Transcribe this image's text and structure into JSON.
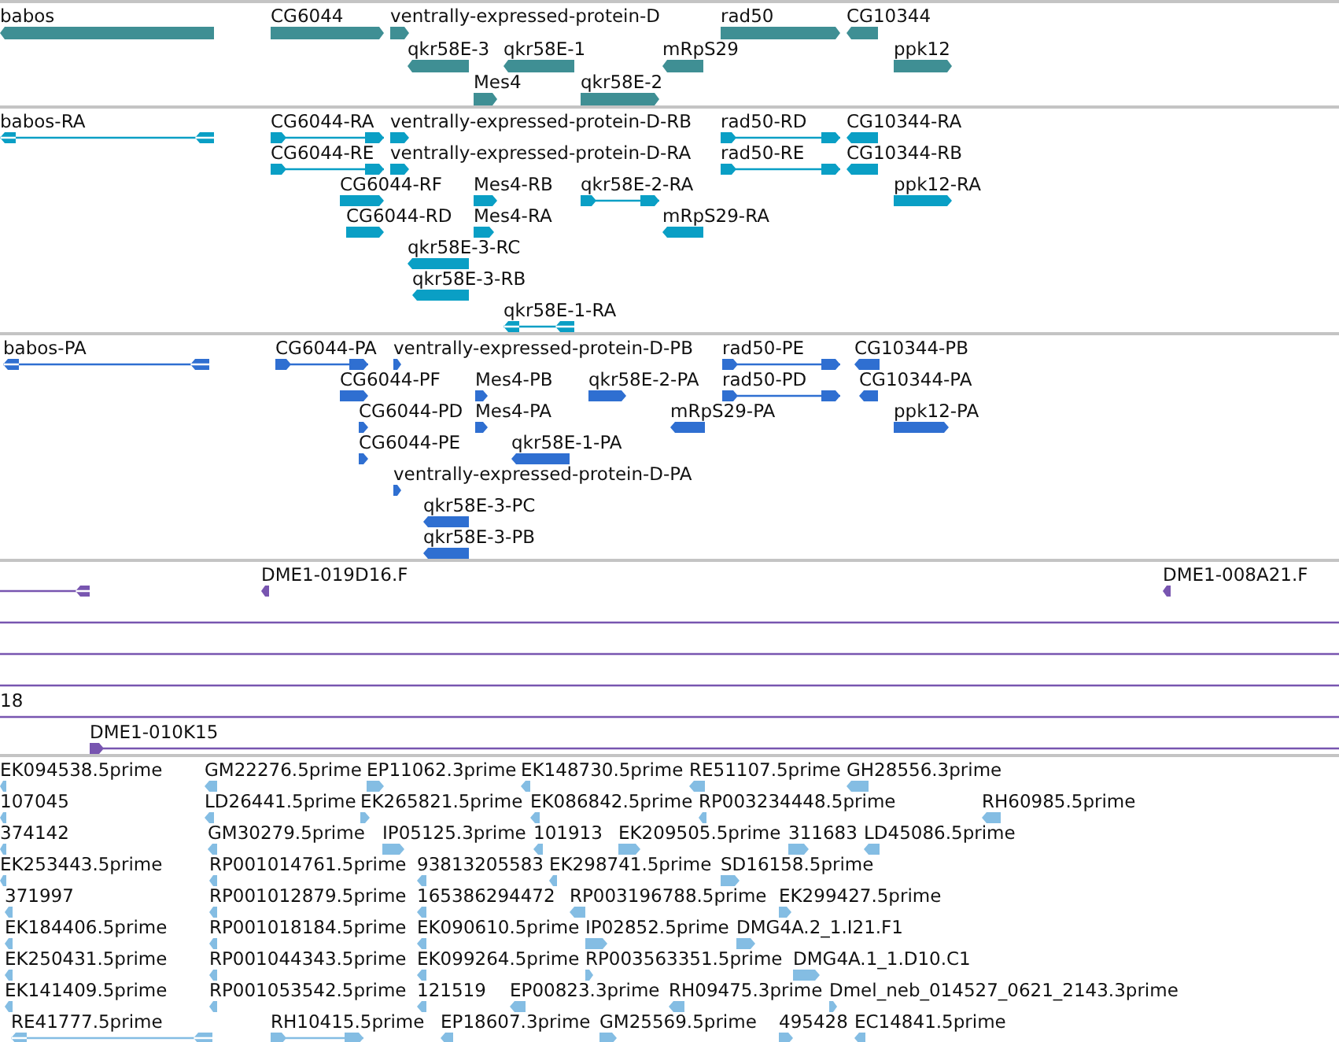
{
  "tracks": [
    {
      "kind": "gene",
      "lanes": [
        {
          "features": [
            {
              "label": "babos",
              "forward": false
            },
            {
              "label": "CG6044",
              "forward": true
            },
            {
              "label": "ventrally-expressed-protein-D",
              "forward": true
            },
            {
              "label": "rad50",
              "forward": true
            },
            {
              "label": "CG10344",
              "forward": false
            }
          ]
        },
        {
          "features": [
            {
              "label": "qkr58E-3",
              "forward": false
            },
            {
              "label": "qkr58E-1",
              "forward": false
            },
            {
              "label": "mRpS29",
              "forward": false
            },
            {
              "label": "ppk12",
              "forward": true
            }
          ]
        },
        {
          "features": [
            {
              "label": "Mes4",
              "forward": true
            },
            {
              "label": "qkr58E-2",
              "forward": true
            }
          ]
        }
      ]
    },
    {
      "kind": "transcript",
      "lanes": [
        {
          "features": [
            {
              "label": "babos-RA",
              "forward": false
            },
            {
              "label": "CG6044-RA",
              "forward": true
            },
            {
              "label": "ventrally-expressed-protein-D-RB",
              "forward": true
            },
            {
              "label": "rad50-RD",
              "forward": true
            },
            {
              "label": "CG10344-RA",
              "forward": false
            }
          ]
        },
        {
          "features": [
            {
              "label": "CG6044-RE",
              "forward": true
            },
            {
              "label": "ventrally-expressed-protein-D-RA",
              "forward": true
            },
            {
              "label": "rad50-RE",
              "forward": true
            },
            {
              "label": "CG10344-RB",
              "forward": false
            }
          ]
        },
        {
          "features": [
            {
              "label": "CG6044-RF",
              "forward": true
            },
            {
              "label": "Mes4-RB",
              "forward": true
            },
            {
              "label": "qkr58E-2-RA",
              "forward": true
            },
            {
              "label": "ppk12-RA",
              "forward": true
            }
          ]
        },
        {
          "features": [
            {
              "label": "CG6044-RD",
              "forward": true
            },
            {
              "label": "Mes4-RA",
              "forward": true
            },
            {
              "label": "mRpS29-RA",
              "forward": false
            }
          ]
        },
        {
          "features": [
            {
              "label": "qkr58E-3-RC",
              "forward": false
            }
          ]
        },
        {
          "features": [
            {
              "label": "qkr58E-3-RB",
              "forward": false
            }
          ]
        },
        {
          "features": [
            {
              "label": "qkr58E-1-RA",
              "forward": false
            }
          ]
        }
      ]
    },
    {
      "kind": "protein",
      "lanes": [
        {
          "features": [
            {
              "label": "babos-PA",
              "forward": false
            },
            {
              "label": "CG6044-PA",
              "forward": true
            },
            {
              "label": "ventrally-expressed-protein-D-PB",
              "forward": true
            },
            {
              "label": "rad50-PE",
              "forward": true
            },
            {
              "label": "CG10344-PB",
              "forward": false
            }
          ]
        },
        {
          "features": [
            {
              "label": "CG6044-PF",
              "forward": true
            },
            {
              "label": "Mes4-PB",
              "forward": true
            },
            {
              "label": "qkr58E-2-PA",
              "forward": true
            },
            {
              "label": "rad50-PD",
              "forward": true
            },
            {
              "label": "CG10344-PA",
              "forward": false
            }
          ]
        },
        {
          "features": [
            {
              "label": "CG6044-PD",
              "forward": true
            },
            {
              "label": "Mes4-PA",
              "forward": true
            },
            {
              "label": "mRpS29-PA",
              "forward": false
            },
            {
              "label": "ppk12-PA",
              "forward": true
            }
          ]
        },
        {
          "features": [
            {
              "label": "CG6044-PE",
              "forward": true
            },
            {
              "label": "qkr58E-1-PA",
              "forward": false
            }
          ]
        },
        {
          "features": [
            {
              "label": "ventrally-expressed-protein-D-PA",
              "forward": true
            }
          ]
        },
        {
          "features": [
            {
              "label": "qkr58E-3-PC",
              "forward": false
            }
          ]
        },
        {
          "features": [
            {
              "label": "qkr58E-3-PB",
              "forward": false
            }
          ]
        }
      ]
    },
    {
      "kind": "bac",
      "lanes": [
        {
          "features": [
            {
              "kind": "arrow",
              "forward": false
            },
            {
              "kind": "arrow",
              "label": "DME1-019D16.F",
              "forward": false
            },
            {
              "kind": "arrow",
              "label": "DME1-008A21.F",
              "forward": false
            }
          ]
        },
        {
          "features": [
            {
              "kind": "line"
            }
          ]
        },
        {
          "features": [
            {
              "kind": "line"
            }
          ]
        },
        {
          "features": [
            {
              "kind": "line"
            }
          ]
        },
        {
          "features": [
            {
              "kind": "line",
              "label": "18"
            }
          ]
        },
        {
          "features": [
            {
              "kind": "arrow",
              "label": "DME1-010K15",
              "forward": true
            }
          ]
        }
      ]
    },
    {
      "kind": "est",
      "lanes": [
        {
          "features": [
            {
              "label": "EK094538.5prime",
              "forward": false
            },
            {
              "label": "GM22276.5prime",
              "forward": false
            },
            {
              "label": "EP11062.3prime",
              "forward": true
            },
            {
              "label": "EK148730.5prime",
              "forward": false
            },
            {
              "label": "RE51107.5prime",
              "forward": false
            },
            {
              "label": "GH28556.3prime",
              "forward": false
            }
          ]
        },
        {
          "features": [
            {
              "label": "107045",
              "forward": false
            },
            {
              "label": "LD26441.5prime",
              "forward": false
            },
            {
              "label": "EK265821.5prime",
              "forward": true
            },
            {
              "label": "EK086842.5prime",
              "forward": false
            },
            {
              "label": "RP003234448.5prime",
              "forward": false
            },
            {
              "label": "RH60985.5prime",
              "forward": false
            }
          ]
        },
        {
          "features": [
            {
              "label": "374142",
              "forward": false
            },
            {
              "label": "GM30279.5prime",
              "forward": false
            },
            {
              "label": "IP05125.3prime",
              "forward": true
            },
            {
              "label": "101913",
              "forward": false
            },
            {
              "label": "EK209505.5prime",
              "forward": true
            },
            {
              "label": "311683",
              "forward": true
            },
            {
              "label": "LD45086.5prime",
              "forward": false
            }
          ]
        },
        {
          "features": [
            {
              "label": "EK253443.5prime",
              "forward": false
            },
            {
              "label": "RP001014761.5prime",
              "forward": false
            },
            {
              "label": "93813205583",
              "forward": false
            },
            {
              "label": "EK298741.5prime",
              "forward": false
            },
            {
              "label": "SD16158.5prime",
              "forward": true
            }
          ]
        },
        {
          "features": [
            {
              "label": "371997",
              "forward": false
            },
            {
              "label": "RP001012879.5prime",
              "forward": false
            },
            {
              "label": "165386294472",
              "forward": false
            },
            {
              "label": "RP003196788.5prime",
              "forward": false
            },
            {
              "label": "EK299427.5prime",
              "forward": true
            }
          ]
        },
        {
          "features": [
            {
              "label": "EK184406.5prime",
              "forward": false
            },
            {
              "label": "RP001018184.5prime",
              "forward": false
            },
            {
              "label": "EK090610.5prime",
              "forward": false
            },
            {
              "label": "IP02852.5prime",
              "forward": true
            },
            {
              "label": "DMG4A.2_1.I21.F1",
              "forward": true
            }
          ]
        },
        {
          "features": [
            {
              "label": "EK250431.5prime",
              "forward": false
            },
            {
              "label": "RP001044343.5prime",
              "forward": false
            },
            {
              "label": "EK099264.5prime",
              "forward": false
            },
            {
              "label": "RP003563351.5prime",
              "forward": true
            },
            {
              "label": "DMG4A.1_1.D10.C1",
              "forward": true
            }
          ]
        },
        {
          "features": [
            {
              "label": "EK141409.5prime",
              "forward": false
            },
            {
              "label": "RP001053542.5prime",
              "forward": false
            },
            {
              "label": "121519",
              "forward": false
            },
            {
              "label": "EP00823.3prime",
              "forward": false
            },
            {
              "label": "RH09475.3prime",
              "forward": false
            },
            {
              "label": "Dmel_neb_014527_0621_2143.3prime",
              "forward": true
            }
          ]
        },
        {
          "features": [
            {
              "label": "RE41777.5prime",
              "forward": false
            },
            {
              "label": "RH10415.5prime",
              "forward": true
            },
            {
              "label": "EP18607.3prime",
              "forward": false
            },
            {
              "label": "GM25569.5prime",
              "forward": true
            },
            {
              "label": "495428",
              "forward": true
            },
            {
              "label": "EC14841.5prime",
              "forward": false
            }
          ]
        }
      ]
    }
  ]
}
